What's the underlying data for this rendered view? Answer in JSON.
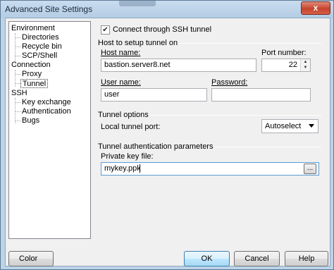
{
  "window": {
    "title": "Advanced Site Settings",
    "close_glyph": "x"
  },
  "tree": {
    "items": [
      {
        "label": "Environment",
        "level": 0
      },
      {
        "label": "Directories",
        "level": 1
      },
      {
        "label": "Recycle bin",
        "level": 1
      },
      {
        "label": "SCP/Shell",
        "level": 1
      },
      {
        "label": "Connection",
        "level": 0
      },
      {
        "label": "Proxy",
        "level": 1
      },
      {
        "label": "Tunnel",
        "level": 1,
        "selected": true
      },
      {
        "label": "SSH",
        "level": 0
      },
      {
        "label": "Key exchange",
        "level": 1
      },
      {
        "label": "Authentication",
        "level": 1
      },
      {
        "label": "Bugs",
        "level": 1
      }
    ]
  },
  "tunnel": {
    "connect_label": "Connect through SSH tunnel",
    "connect_checked": true,
    "host_group_title": "Host to setup tunnel on",
    "host_label": "Host name:",
    "host_value": "bastion.server8.net",
    "port_label": "Port number:",
    "port_value": "22",
    "user_label": "User name:",
    "user_value": "user",
    "password_label": "Password:",
    "password_value": "",
    "options_group_title": "Tunnel options",
    "local_port_label": "Local tunnel port:",
    "local_port_value": "Autoselect",
    "auth_group_title": "Tunnel authentication parameters",
    "key_label": "Private key file:",
    "key_value": "mykey.ppk",
    "browse_label": "..."
  },
  "footer": {
    "color_label": "Color",
    "ok_label": "OK",
    "cancel_label": "Cancel",
    "help_label": "Help"
  }
}
